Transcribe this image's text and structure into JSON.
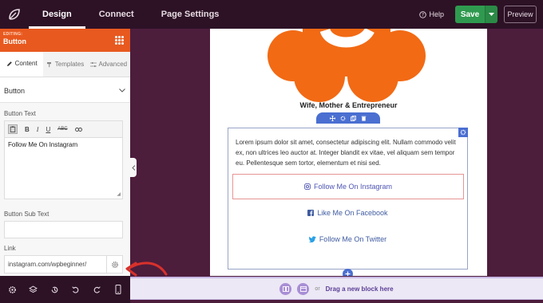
{
  "topbar": {
    "tabs": [
      {
        "label": "Design"
      },
      {
        "label": "Connect"
      },
      {
        "label": "Page Settings"
      }
    ],
    "help_label": "Help",
    "save_label": "Save",
    "preview_label": "Preview"
  },
  "panel": {
    "editing_label": "EDITING:",
    "title": "Button",
    "tabs": [
      {
        "label": "Content",
        "icon": "pencil-icon"
      },
      {
        "label": "Templates",
        "icon": "paint-roller-icon"
      },
      {
        "label": "Advanced",
        "icon": "sliders-icon"
      }
    ],
    "section_title": "Button",
    "button_text_label": "Button Text",
    "button_text_value": "Follow Me On Instagram",
    "sub_text_label": "Button Sub Text",
    "sub_text_value": "",
    "link_label": "Link",
    "link_value": "instagram.com/wpbeginner/"
  },
  "canvas": {
    "tagline": "Wife, Mother & Entrepreneur",
    "lorem": "Lorem ipsum dolor sit amet, consectetur adipiscing elit. Nullam commodo velit ex, non ultrices leo auctor at. Integer blandit ex vitae, vel aliquam sem tempor eu. Pellentesque sem tortor, elementum et nisi sed.",
    "buttons": [
      {
        "label": "Follow Me On Instagram",
        "icon": "instagram-icon"
      },
      {
        "label": "Like Me On Facebook",
        "icon": "facebook-icon"
      },
      {
        "label": "Follow Me On Twitter",
        "icon": "twitter-icon"
      }
    ]
  },
  "dropbar": {
    "or_label": "or",
    "text": "Drag a new block here"
  },
  "colors": {
    "accent_orange": "#e8591f",
    "save_green": "#2f9a4f",
    "topbar": "#2d1226",
    "background": "#4d1d3c",
    "block_blue": "#4a6fd1",
    "arrow_red": "#d8312b"
  }
}
